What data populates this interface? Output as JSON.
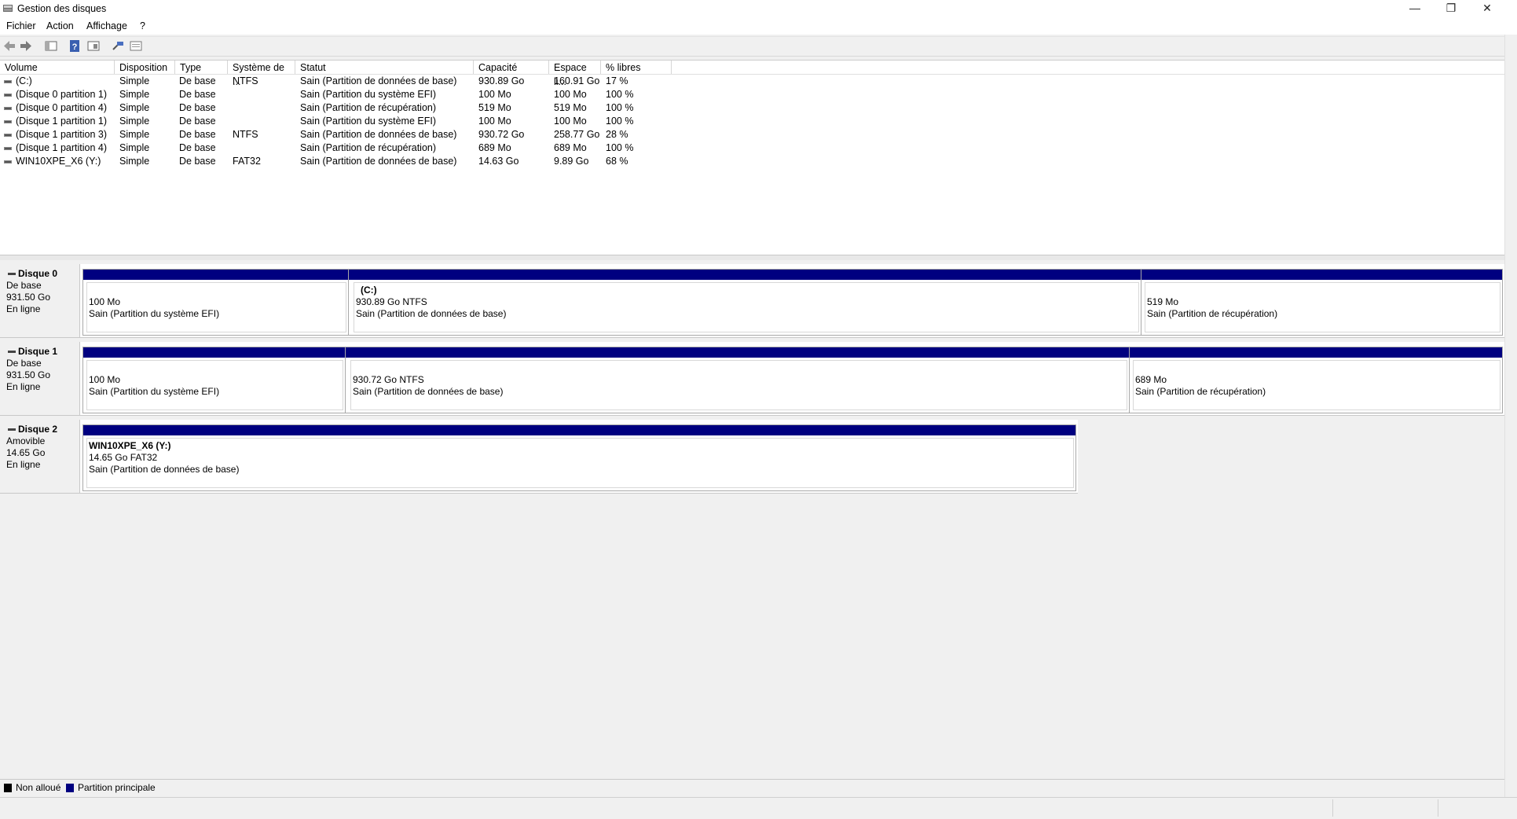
{
  "window": {
    "title": "Gestion des disques",
    "minimize_icon": "minimize-icon",
    "maximize_icon": "restore-icon",
    "close_icon": "close-icon",
    "minimize_glyph": "—",
    "restore_glyph": "❐",
    "close_glyph": "✕"
  },
  "menu": {
    "items": [
      "Fichier",
      "Action",
      "Affichage",
      "?"
    ]
  },
  "toolbar": {
    "buttons": [
      "back-icon",
      "forward-icon",
      "console-tree-icon",
      "help-icon",
      "properties-view-icon",
      "refresh-icon",
      "list-view-icon"
    ]
  },
  "volumes": {
    "columns": [
      "Volume",
      "Disposition",
      "Type",
      "Système de ...",
      "Statut",
      "Capacité",
      "Espace li...",
      "% libres"
    ],
    "rows": [
      {
        "volume": " (C:)",
        "disposition": "Simple",
        "type": "De base",
        "fs": "NTFS",
        "status": "Sain (Partition de données de base)",
        "capacity": "930.89 Go",
        "free": "160.91 Go",
        "pct": "17 %"
      },
      {
        "volume": "(Disque 0 partition 1)",
        "disposition": "Simple",
        "type": "De base",
        "fs": "",
        "status": "Sain (Partition du système EFI)",
        "capacity": "100 Mo",
        "free": "100 Mo",
        "pct": "100 %"
      },
      {
        "volume": "(Disque 0 partition 4)",
        "disposition": "Simple",
        "type": "De base",
        "fs": "",
        "status": "Sain (Partition de récupération)",
        "capacity": "519 Mo",
        "free": "519 Mo",
        "pct": "100 %"
      },
      {
        "volume": "(Disque 1 partition 1)",
        "disposition": "Simple",
        "type": "De base",
        "fs": "",
        "status": "Sain (Partition du système EFI)",
        "capacity": "100 Mo",
        "free": "100 Mo",
        "pct": "100 %"
      },
      {
        "volume": "(Disque 1 partition 3)",
        "disposition": "Simple",
        "type": "De base",
        "fs": "NTFS",
        "status": "Sain (Partition de données de base)",
        "capacity": "930.72 Go",
        "free": "258.77 Go",
        "pct": "28 %"
      },
      {
        "volume": "(Disque 1 partition 4)",
        "disposition": "Simple",
        "type": "De base",
        "fs": "",
        "status": "Sain (Partition de récupération)",
        "capacity": "689 Mo",
        "free": "689 Mo",
        "pct": "100 %"
      },
      {
        "volume": "WIN10XPE_X6 (Y:)",
        "disposition": "Simple",
        "type": "De base",
        "fs": "FAT32",
        "status": "Sain (Partition de données de base)",
        "capacity": "14.63 Go",
        "free": "9.89 Go",
        "pct": "68 %"
      }
    ]
  },
  "disks": [
    {
      "name": "Disque 0",
      "kind": "De base",
      "size": "931.50 Go",
      "state": "En ligne",
      "partitions": [
        {
          "name": "",
          "size": "100 Mo",
          "status": "Sain (Partition du système EFI)"
        },
        {
          "name": "(C:)",
          "size": "930.89 Go NTFS",
          "status": "Sain (Partition de données de base)"
        },
        {
          "name": "",
          "size": "519 Mo",
          "status": "Sain (Partition de récupération)"
        }
      ]
    },
    {
      "name": "Disque 1",
      "kind": "De base",
      "size": "931.50 Go",
      "state": "En ligne",
      "partitions": [
        {
          "name": "",
          "size": "100 Mo",
          "status": "Sain (Partition du système EFI)"
        },
        {
          "name": "",
          "size": "930.72 Go NTFS",
          "status": "Sain (Partition de données de base)"
        },
        {
          "name": "",
          "size": "689 Mo",
          "status": "Sain (Partition de récupération)"
        }
      ]
    },
    {
      "name": "Disque 2",
      "kind": "Amovible",
      "size": "14.65 Go",
      "state": "En ligne",
      "partitions": [
        {
          "name": "WIN10XPE_X6  (Y:)",
          "size": "14.65 Go FAT32",
          "status": "Sain (Partition de données de base)"
        }
      ]
    }
  ],
  "legend": {
    "unallocated": "Non alloué",
    "primary": "Partition principale",
    "unallocated_color": "#000000",
    "primary_color": "#000080"
  }
}
